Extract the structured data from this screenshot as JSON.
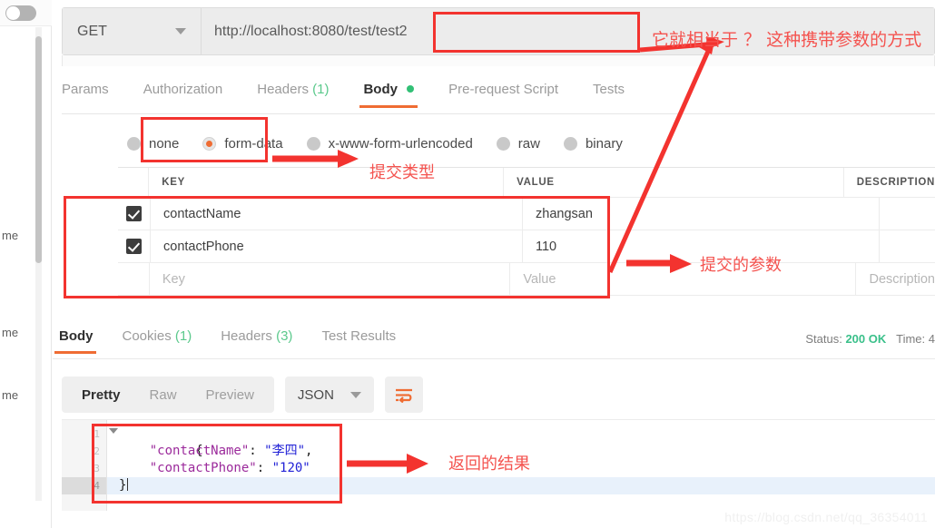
{
  "sidebar": {
    "toggle_name": "sidebar-toggle",
    "fragments": [
      "me",
      "me",
      "me"
    ]
  },
  "request": {
    "method": "GET",
    "url": "http://localhost:8080/test/test2",
    "tabs": [
      {
        "label": "Params",
        "active": false,
        "count": "",
        "dot": false
      },
      {
        "label": "Authorization",
        "active": false,
        "count": "",
        "dot": false
      },
      {
        "label": "Headers",
        "active": false,
        "count": "(1)",
        "dot": false
      },
      {
        "label": "Body",
        "active": true,
        "count": "",
        "dot": true
      },
      {
        "label": "Pre-request Script",
        "active": false,
        "count": "",
        "dot": false
      },
      {
        "label": "Tests",
        "active": false,
        "count": "",
        "dot": false
      }
    ],
    "body_types": [
      {
        "label": "none",
        "selected": false
      },
      {
        "label": "form-data",
        "selected": true
      },
      {
        "label": "x-www-form-urlencoded",
        "selected": false
      },
      {
        "label": "raw",
        "selected": false
      },
      {
        "label": "binary",
        "selected": false
      }
    ],
    "table": {
      "headers": {
        "key": "KEY",
        "value": "VALUE",
        "description": "DESCRIPTION"
      },
      "rows": [
        {
          "checked": true,
          "key": "contactName",
          "value": "zhangsan",
          "description": ""
        },
        {
          "checked": true,
          "key": "contactPhone",
          "value": "110",
          "description": ""
        }
      ],
      "placeholder_row": {
        "key": "Key",
        "value": "Value",
        "description": "Description"
      }
    }
  },
  "response": {
    "tabs": [
      {
        "label": "Body",
        "active": true,
        "count": ""
      },
      {
        "label": "Cookies",
        "active": false,
        "count": "(1)"
      },
      {
        "label": "Headers",
        "active": false,
        "count": "(3)"
      },
      {
        "label": "Test Results",
        "active": false,
        "count": ""
      }
    ],
    "status_label": "Status:",
    "status_value": "200 OK",
    "time_label": "Time:",
    "format_tabs": [
      {
        "label": "Pretty",
        "active": true
      },
      {
        "label": "Raw",
        "active": false
      },
      {
        "label": "Preview",
        "active": false
      }
    ],
    "format_type": "JSON",
    "wrap_icon": "word-wrap-icon",
    "code_lines": [
      {
        "num": "1",
        "text": "{",
        "current": false
      },
      {
        "num": "2",
        "key": "\"contactName\"",
        "sep": ": ",
        "val": "\"李四\"",
        "tail": ",",
        "current": false
      },
      {
        "num": "3",
        "key": "\"contactPhone\"",
        "sep": ": ",
        "val": "\"120\"",
        "tail": "",
        "current": false
      },
      {
        "num": "4",
        "text": "}",
        "current": true
      }
    ]
  },
  "annotations": {
    "url_note": "它就相当于 ？ 这种携带参数的方式",
    "type_note": "提交类型",
    "params_note": "提交的参数",
    "result_note": "返回的结果"
  },
  "watermark": "https://blog.csdn.net/qq_36354011",
  "colors": {
    "accent": "#ef6c33",
    "annotation": "#f4534f",
    "status_ok": "#3ac08a"
  }
}
